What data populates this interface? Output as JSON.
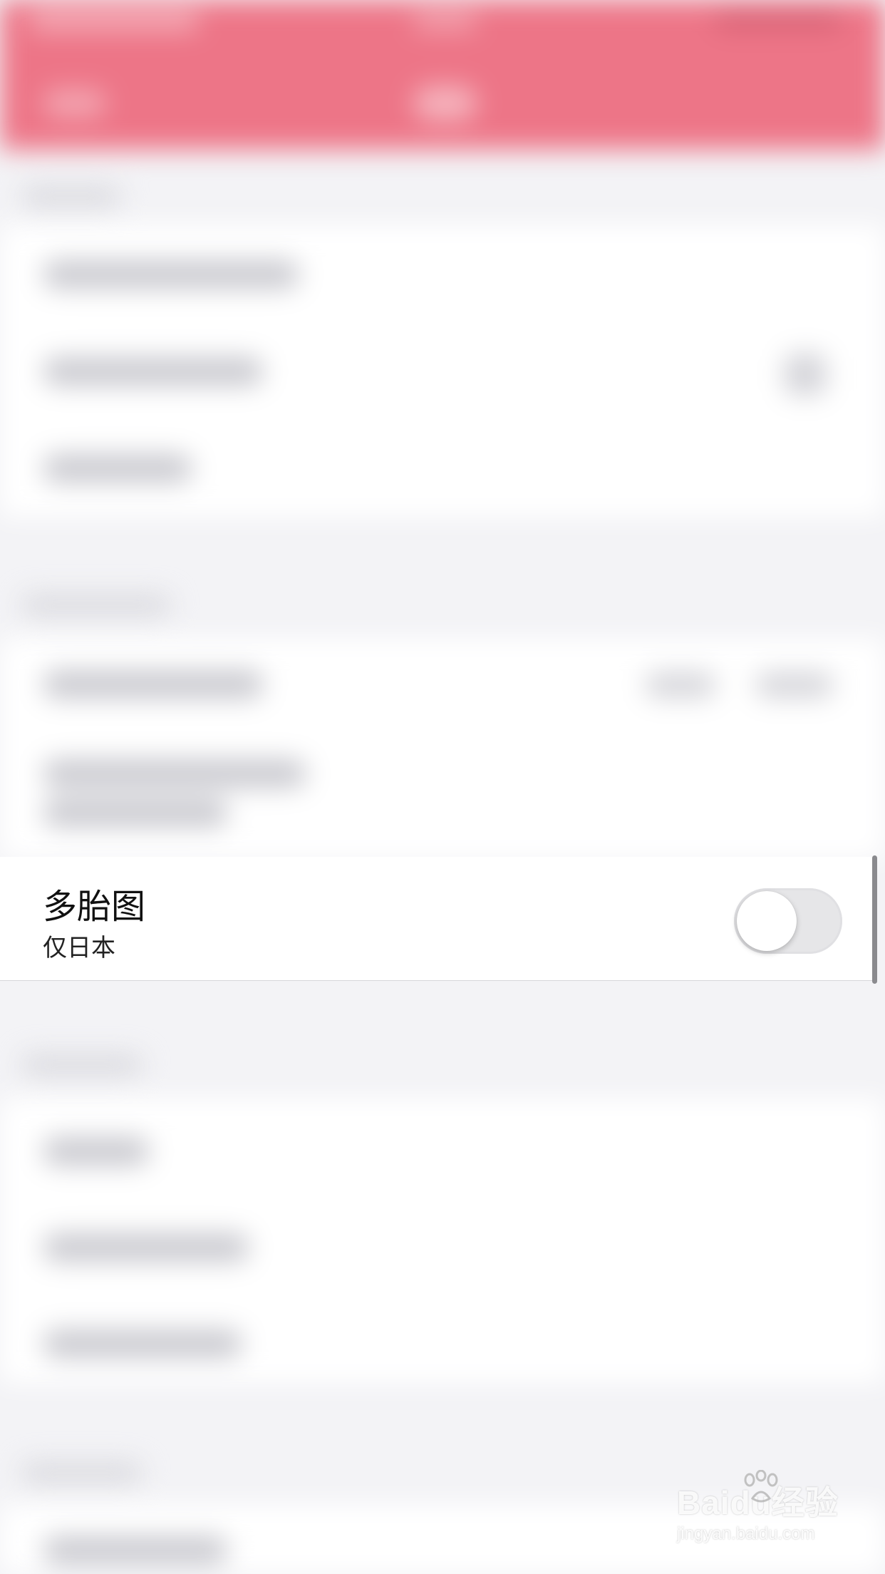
{
  "setting": {
    "title": "多胎图",
    "subtitle": "仅日本",
    "enabled": false
  },
  "watermark": {
    "logo": "Baidu经验",
    "url": "jingyan.baidu.com"
  }
}
